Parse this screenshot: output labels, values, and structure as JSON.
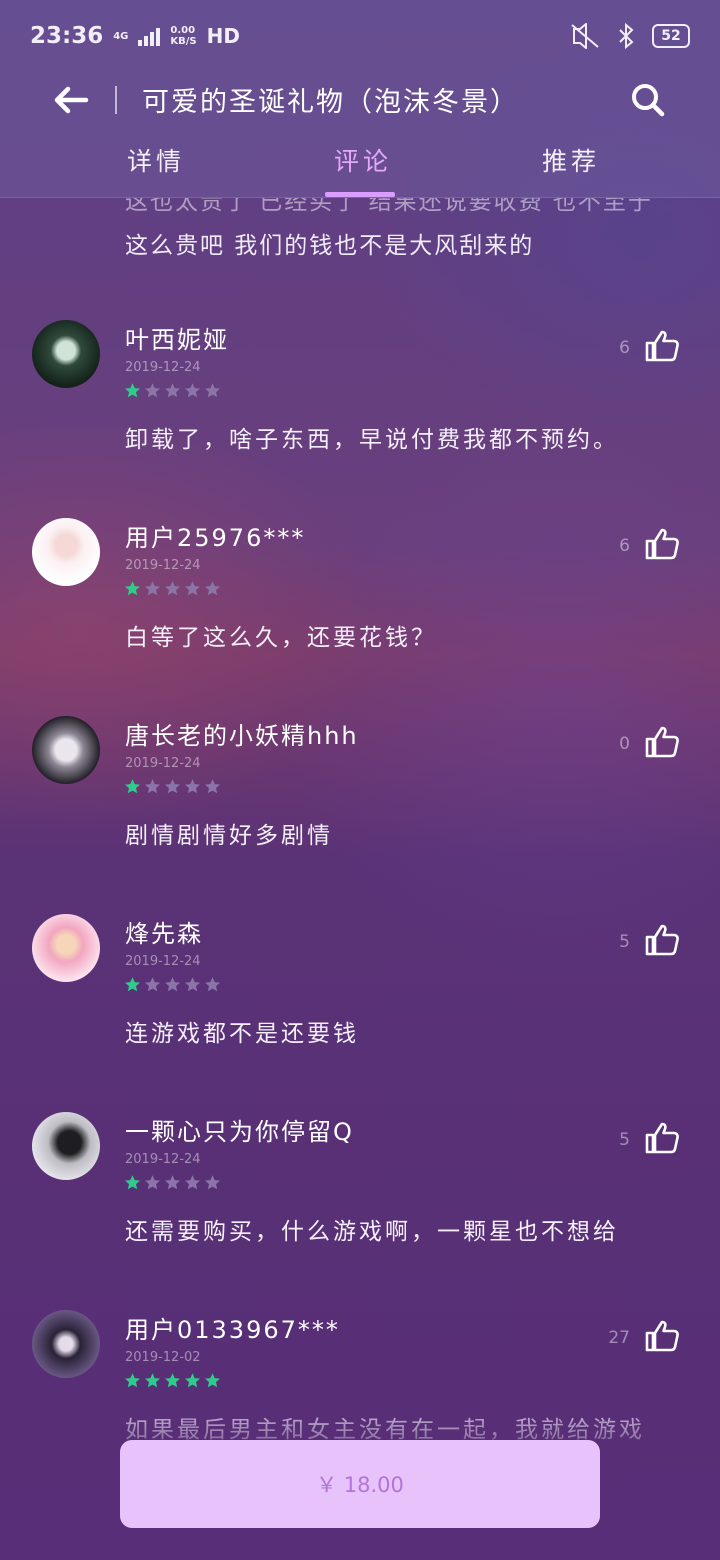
{
  "status_bar": {
    "time": "23:36",
    "network_type": "4G",
    "speed_value": "0.00",
    "speed_unit": "KB/S",
    "hd_label": "HD",
    "battery": "52"
  },
  "header": {
    "title": "可爱的圣诞礼物（泡沫冬景）",
    "tabs": [
      {
        "label": "详情",
        "active": false
      },
      {
        "label": "评论",
        "active": true
      },
      {
        "label": "推荐",
        "active": false
      }
    ]
  },
  "previous_comment": {
    "partial_line": "这么贵吧 我们的钱也不是大风刮来的",
    "cut_line": "这也太贵了 已经买了 结果还说要收费 也不至于"
  },
  "reviews": [
    {
      "user": "叶西妮娅",
      "date": "2019-12-24",
      "rating": 1,
      "likes": "6",
      "comment": "卸载了，啥子东西，早说付费我都不预约。",
      "avatar": "dark-green"
    },
    {
      "user": "用户25976***",
      "date": "2019-12-24",
      "rating": 1,
      "likes": "6",
      "comment": "白等了这么久，还要花钱？",
      "avatar": "white-pink"
    },
    {
      "user": "唐长老的小妖精hhh",
      "date": "2019-12-24",
      "rating": 1,
      "likes": "0",
      "comment": "剧情剧情好多剧情",
      "avatar": "dark-gray"
    },
    {
      "user": "烽先森",
      "date": "2019-12-24",
      "rating": 1,
      "likes": "5",
      "comment": "连游戏都不是还要钱",
      "avatar": "pink"
    },
    {
      "user": "一颗心只为你停留Q",
      "date": "2019-12-24",
      "rating": 1,
      "likes": "5",
      "comment": "还需要购买，什么游戏啊，一颗星也不想给",
      "avatar": "gray"
    },
    {
      "user": "用户0133967***",
      "date": "2019-12-02",
      "rating": 5,
      "likes": "27",
      "comment": "如果最后男主和女主没有在一起，我就给游戏",
      "avatar": "purple"
    }
  ],
  "buy_button": {
    "label": "￥ 18.00"
  },
  "colors": {
    "star_filled": "#2ecc8a",
    "star_empty": "#8a74a8",
    "tab_active": "#e6a8ff",
    "buy_bg": "#e8c3fb"
  },
  "icons": [
    "back-arrow-icon",
    "search-icon",
    "thumbs-up-icon",
    "star-icon",
    "wifi-icon",
    "bluetooth-icon",
    "mute-icon",
    "battery-icon"
  ]
}
